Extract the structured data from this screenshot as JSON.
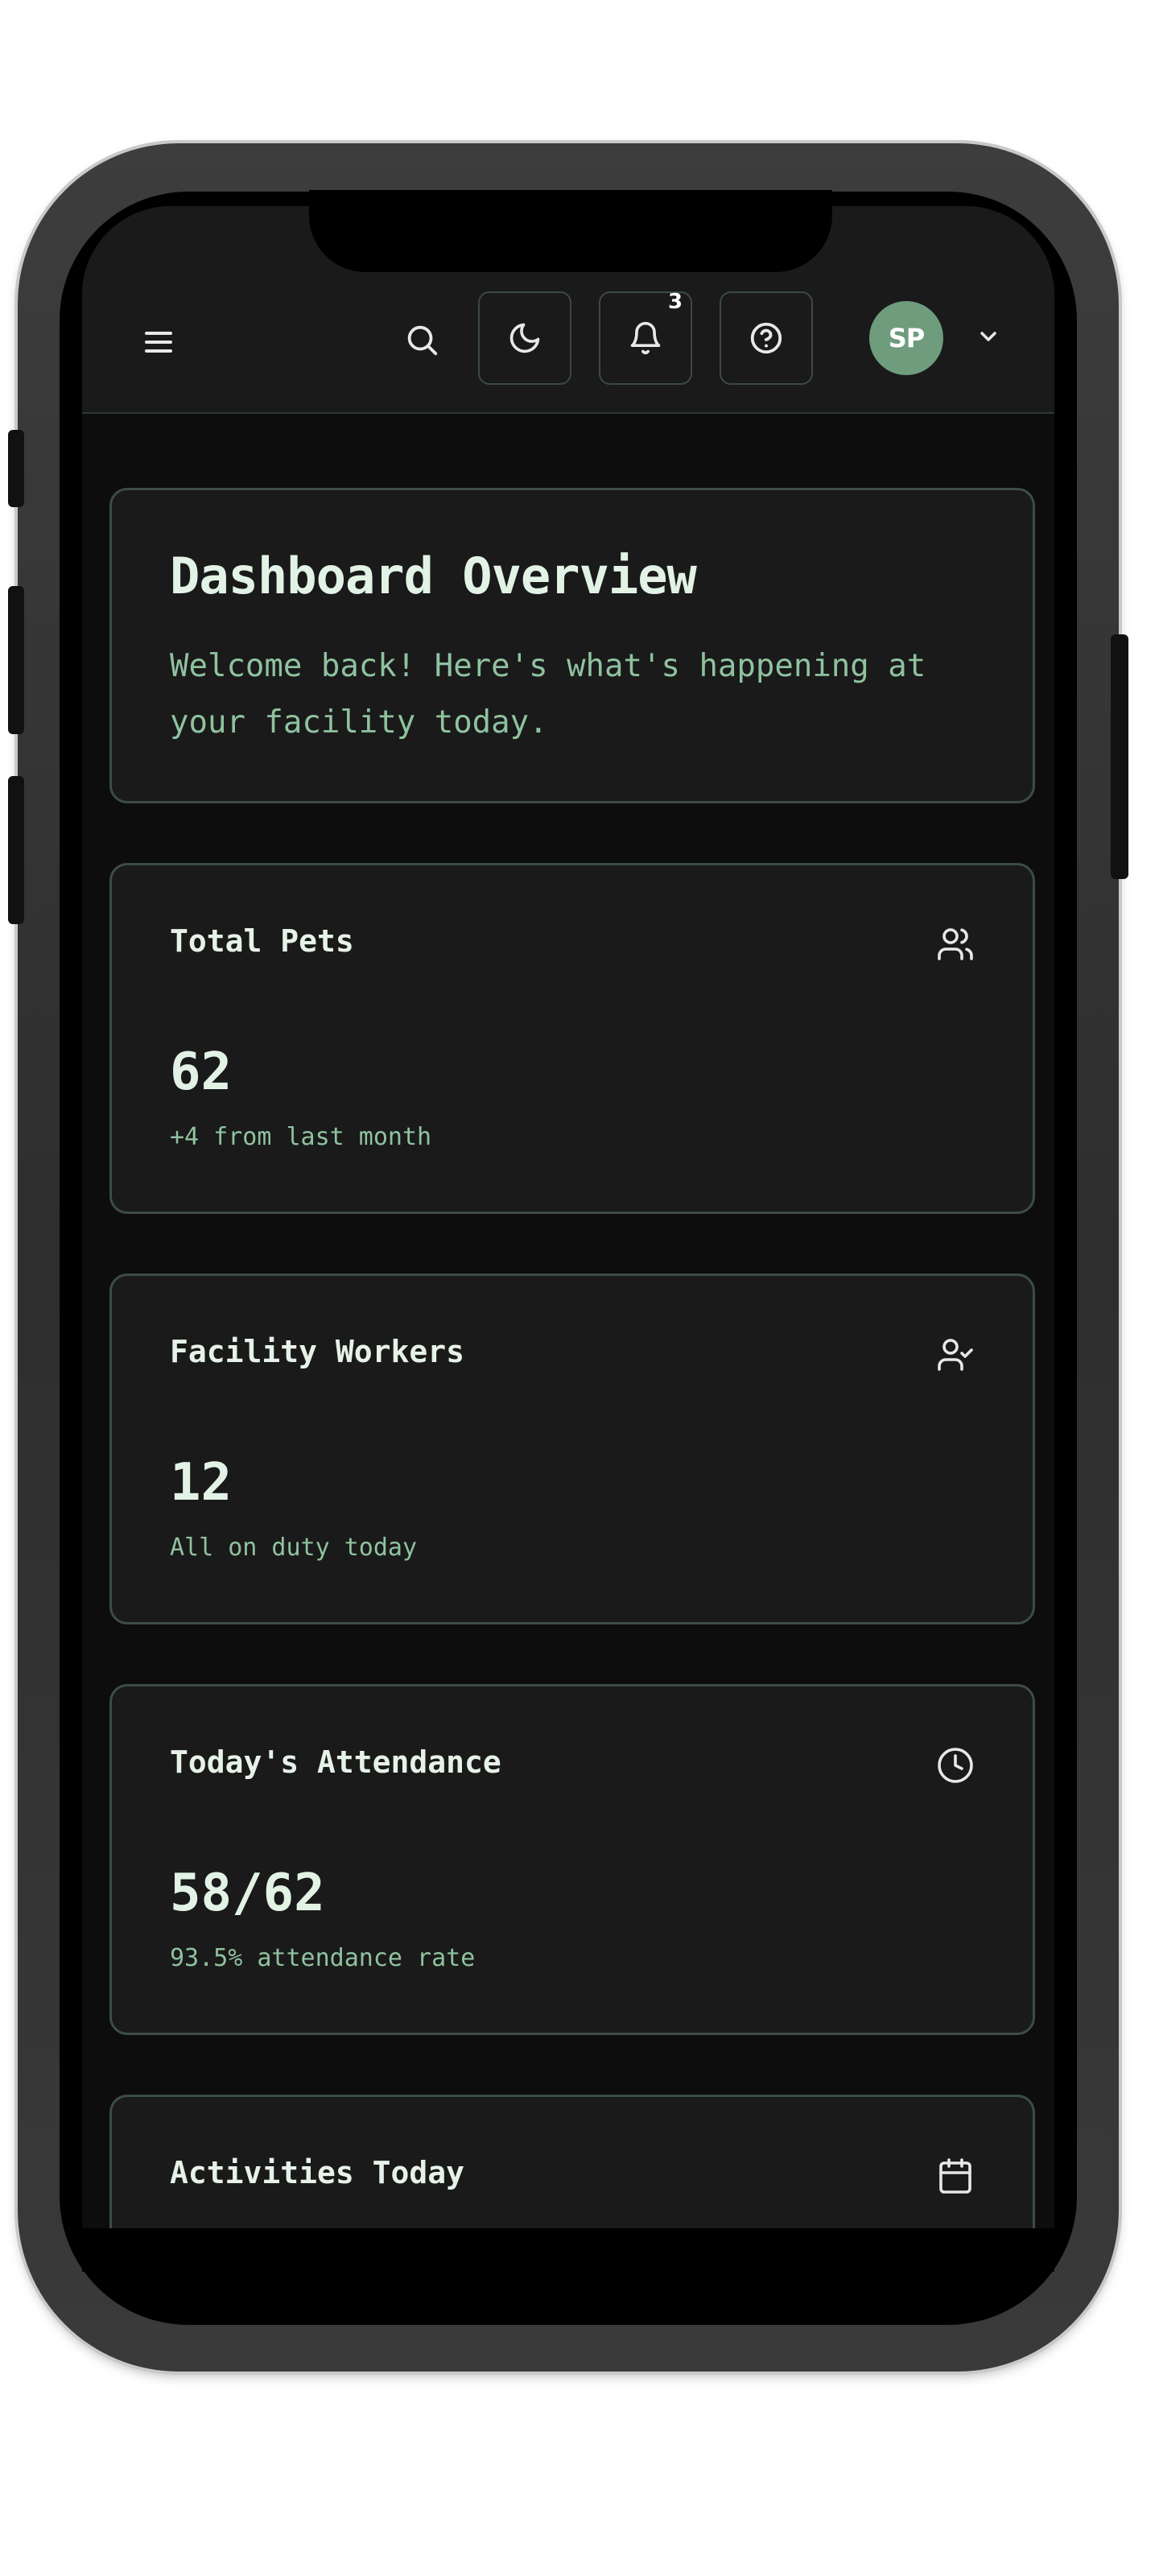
{
  "header": {
    "notification_count": "3",
    "avatar_initials": "SP",
    "icons": {
      "menu": "hamburger-menu-icon",
      "search": "search-icon",
      "theme": "moon-icon",
      "notifications": "bell-icon",
      "help": "help-circle-icon",
      "account_menu": "chevron-down-icon"
    }
  },
  "welcome": {
    "title": "Dashboard Overview",
    "subtitle": "Welcome back! Here's what's happening at your facility today."
  },
  "stats": [
    {
      "title": "Total Pets",
      "value": "62",
      "note": "+4 from last month",
      "icon": "users-icon"
    },
    {
      "title": "Facility Workers",
      "value": "12",
      "note": "All on duty today",
      "icon": "user-check-icon"
    },
    {
      "title": "Today's Attendance",
      "value": "58/62",
      "note": "93.5% attendance rate",
      "icon": "clock-icon"
    },
    {
      "title": "Activities Today",
      "icon": "calendar-icon"
    }
  ],
  "colors": {
    "background": "#0d0d0d",
    "surface": "#1a1a1a",
    "border": "#3c4d44",
    "accent": "#8fc29f",
    "heading": "#e2f3e6",
    "avatar": "#6e9c7d"
  }
}
